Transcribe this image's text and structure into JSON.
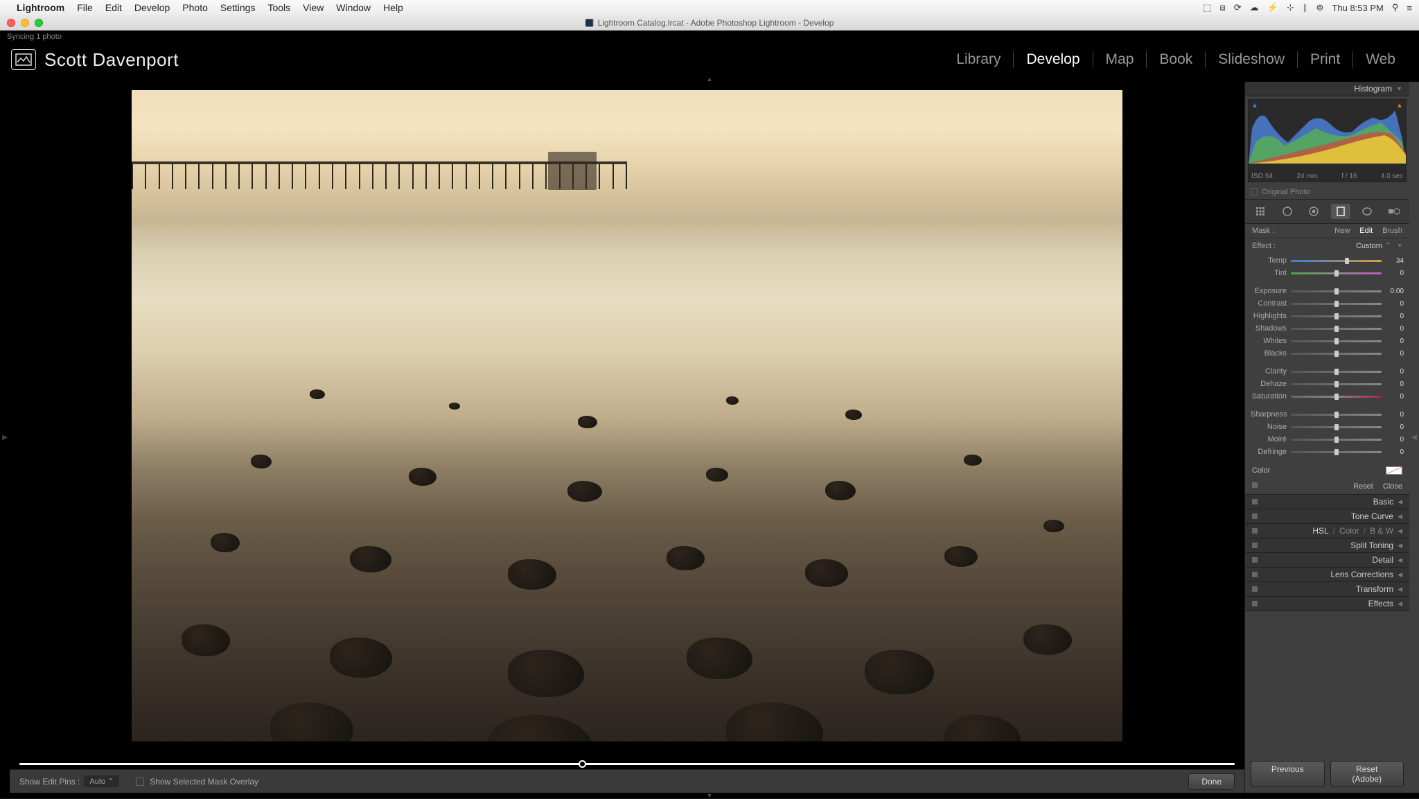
{
  "mac_menu": {
    "app": "Lightroom",
    "items": [
      "File",
      "Edit",
      "Develop",
      "Photo",
      "Settings",
      "Tools",
      "View",
      "Window",
      "Help"
    ],
    "clock": "Thu 8:53 PM"
  },
  "window_title": "Lightroom Catalog.lrcat - Adobe Photoshop Lightroom - Develop",
  "sync_status": "Syncing 1 photo",
  "identity_name": "Scott Davenport",
  "modules": [
    {
      "label": "Library",
      "active": false
    },
    {
      "label": "Develop",
      "active": true
    },
    {
      "label": "Map",
      "active": false
    },
    {
      "label": "Book",
      "active": false
    },
    {
      "label": "Slideshow",
      "active": false
    },
    {
      "label": "Print",
      "active": false
    },
    {
      "label": "Web",
      "active": false
    }
  ],
  "bottom_toolbar": {
    "pins_label": "Show Edit Pins :",
    "pins_value": "Auto",
    "overlay_label": "Show Selected Mask Overlay",
    "done": "Done"
  },
  "right_panel": {
    "histogram_label": "Histogram",
    "histo_meta": {
      "iso": "ISO 64",
      "focal": "24 mm",
      "aperture": "f / 16",
      "shutter": "4.0 sec"
    },
    "original_photo": "Original Photo",
    "mask_row": {
      "label": "Mask :",
      "new": "New",
      "edit": "Edit",
      "brush": "Brush"
    },
    "effect_row": {
      "label": "Effect :",
      "value": "Custom"
    },
    "sliders_group1": [
      {
        "label": "Temp",
        "value": "34",
        "pos": 62,
        "cls": "temp"
      },
      {
        "label": "Tint",
        "value": "0",
        "pos": 50,
        "cls": "tint"
      }
    ],
    "sliders_group2": [
      {
        "label": "Exposure",
        "value": "0.00",
        "pos": 50
      },
      {
        "label": "Contrast",
        "value": "0",
        "pos": 50
      },
      {
        "label": "Highlights",
        "value": "0",
        "pos": 50
      },
      {
        "label": "Shadows",
        "value": "0",
        "pos": 50
      },
      {
        "label": "Whites",
        "value": "0",
        "pos": 50
      },
      {
        "label": "Blacks",
        "value": "0",
        "pos": 50
      }
    ],
    "sliders_group3": [
      {
        "label": "Clarity",
        "value": "0",
        "pos": 50
      },
      {
        "label": "Dehaze",
        "value": "0",
        "pos": 50
      },
      {
        "label": "Saturation",
        "value": "0",
        "pos": 50,
        "cls": "sat"
      }
    ],
    "sliders_group4": [
      {
        "label": "Sharpness",
        "value": "0",
        "pos": 50
      },
      {
        "label": "Noise",
        "value": "0",
        "pos": 50
      },
      {
        "label": "Moiré",
        "value": "0",
        "pos": 50
      },
      {
        "label": "Defringe",
        "value": "0",
        "pos": 50
      }
    ],
    "color_label": "Color",
    "reset": "Reset",
    "close": "Close",
    "panels": [
      {
        "label": "Basic"
      },
      {
        "label": "Tone Curve"
      },
      {
        "label_parts": [
          "HSL",
          "Color",
          "B & W"
        ],
        "hsl": true
      },
      {
        "label": "Split Toning"
      },
      {
        "label": "Detail"
      },
      {
        "label": "Lens Corrections"
      },
      {
        "label": "Transform"
      },
      {
        "label": "Effects"
      }
    ],
    "buttons": {
      "previous": "Previous",
      "reset_adobe": "Reset (Adobe)"
    }
  }
}
